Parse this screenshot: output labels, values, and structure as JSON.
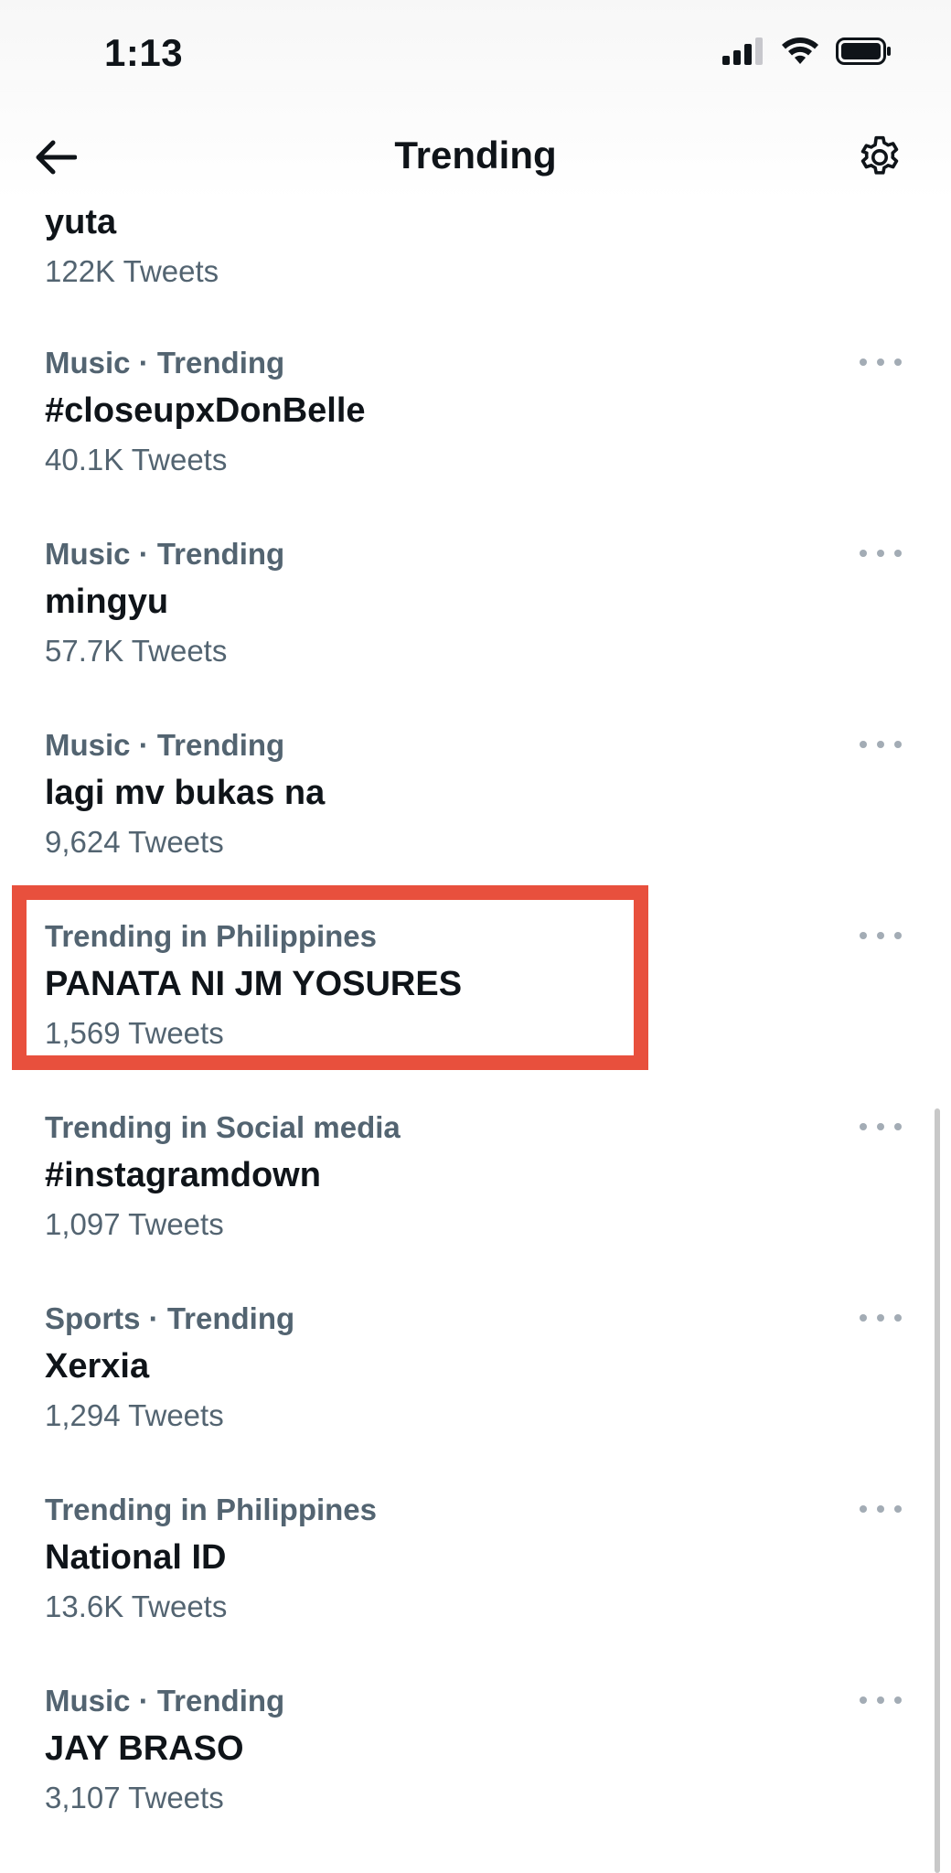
{
  "status_bar": {
    "time": "1:13",
    "icons": [
      "cellular-signal-icon",
      "wifi-icon",
      "battery-icon"
    ]
  },
  "nav": {
    "title": "Trending",
    "back_icon": "arrow-left-icon",
    "settings_icon": "gear-icon"
  },
  "trends": [
    {
      "context": "",
      "name": "yuta",
      "count": "122K Tweets",
      "has_more": false
    },
    {
      "context": "Music · Trending",
      "name": "#closeupxDonBelle",
      "count": "40.1K Tweets",
      "has_more": true
    },
    {
      "context": "Music · Trending",
      "name": "mingyu",
      "count": "57.7K Tweets",
      "has_more": true
    },
    {
      "context": "Music · Trending",
      "name": "lagi mv bukas na",
      "count": "9,624 Tweets",
      "has_more": true
    },
    {
      "context": "Trending in Philippines",
      "name": "PANATA NI JM YOSURES",
      "count": "1,569 Tweets",
      "has_more": true,
      "highlighted": true
    },
    {
      "context": "Trending in Social media",
      "name": "#instagramdown",
      "count": "1,097 Tweets",
      "has_more": true
    },
    {
      "context": "Sports · Trending",
      "name": "Xerxia",
      "count": "1,294 Tweets",
      "has_more": true
    },
    {
      "context": "Trending in Philippines",
      "name": "National ID",
      "count": "13.6K Tweets",
      "has_more": true
    },
    {
      "context": "Music · Trending",
      "name": "JAY BRASO",
      "count": "3,107 Tweets",
      "has_more": true
    }
  ],
  "colors": {
    "highlight": "#e8503d",
    "secondary_text": "#536471",
    "primary_text": "#0f1419"
  }
}
